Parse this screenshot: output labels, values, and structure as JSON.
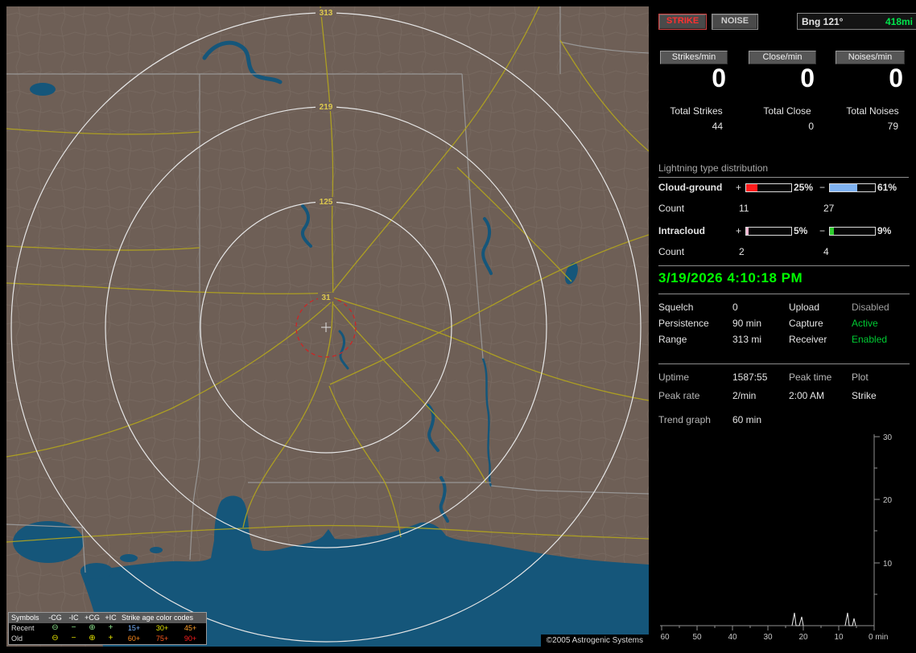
{
  "map": {
    "range_labels": [
      "313",
      "219",
      "125",
      "31"
    ],
    "copyright": "©2005 Astrogenic Systems",
    "colors": {
      "land": "#6e5f56",
      "water": "#15567a",
      "road": "#b3a51d",
      "state_border": "#9c9c9c",
      "range_ring": "#e6e6e6",
      "range_label": "#dcc84e",
      "alarm_ring": "#cc2525"
    },
    "legend": {
      "symbols_title": "Symbols",
      "symbol_columns": [
        "-CG",
        "-IC",
        "+CG",
        "+IC"
      ],
      "age_title": "Strike age color codes",
      "rows": [
        {
          "label": "Recent",
          "symbols": [
            "⊖",
            "−",
            "⊕",
            "+"
          ],
          "symbol_color": "#8ce08c",
          "ages": [
            "15+",
            "30+",
            "45+"
          ],
          "age_colors": [
            "#79b4ff",
            "#e6e600",
            "#ffa02a"
          ]
        },
        {
          "label": "Old",
          "symbols": [
            "⊖",
            "−",
            "⊕",
            "+"
          ],
          "symbol_color": "#e2e200",
          "ages": [
            "60+",
            "75+",
            "90+"
          ],
          "age_colors": [
            "#ff8c1e",
            "#ff5a1e",
            "#ff1e1e"
          ]
        }
      ]
    }
  },
  "panel": {
    "mode_buttons": [
      {
        "label": "STRIKE",
        "color": "#ff3030"
      },
      {
        "label": "NOISE",
        "color": "#cccccc"
      }
    ],
    "bearing": {
      "label": "Bng 121°",
      "distance": "418mi",
      "distance_color": "#00e64d"
    },
    "rate_columns": [
      {
        "label": "Strikes/min",
        "value": "0",
        "total_label": "Total Strikes",
        "total_value": "44"
      },
      {
        "label": "Close/min",
        "value": "0",
        "total_label": "Total Close",
        "total_value": "0"
      },
      {
        "label": "Noises/min",
        "value": "0",
        "total_label": "Total Noises",
        "total_value": "79"
      }
    ],
    "distribution": {
      "title": "Lightning type distribution",
      "rows": [
        {
          "label": "Cloud-ground",
          "plus": "+",
          "minus": "−",
          "pos_pct": "25%",
          "pos_fill": "25%",
          "pos_color": "#ff1c1c",
          "neg_pct": "61%",
          "neg_fill": "61%",
          "neg_color": "#7fb2f0",
          "count_label": "Count",
          "pos_count": "11",
          "neg_count": "27"
        },
        {
          "label": "Intracloud",
          "plus": "+",
          "minus": "−",
          "pos_pct": "5%",
          "pos_fill": "5%",
          "pos_color": "#f2b6d2",
          "neg_pct": "9%",
          "neg_fill": "9%",
          "neg_color": "#2ecc2e",
          "count_label": "Count",
          "pos_count": "2",
          "neg_count": "4"
        }
      ]
    },
    "timestamp": {
      "text": "3/19/2026 4:10:18 PM",
      "color": "#00ff00"
    },
    "status_rows": [
      {
        "label": "Squelch",
        "value": "0",
        "label2": "Upload",
        "value2": "Disabled",
        "value2_color": "#a0a0a0"
      },
      {
        "label": "Persistence",
        "value": "90 min",
        "label2": "Capture",
        "value2": "Active",
        "value2_color": "#00cc33"
      },
      {
        "label": "Range",
        "value": "313 mi",
        "label2": "Receiver",
        "value2": "Enabled",
        "value2_color": "#00cc33"
      }
    ],
    "stats_grid": {
      "r1": [
        "Uptime",
        "1587:55",
        "Peak time",
        "Plot"
      ],
      "r2": [
        "Peak rate",
        "2/min",
        "2:00 AM",
        "Strike"
      ]
    },
    "trend": {
      "label": "Trend graph",
      "value": "60 min"
    },
    "trend_graph": {
      "type": "line",
      "ylim": [
        0,
        30
      ],
      "xlim_min_ago": [
        60,
        0
      ],
      "y_ticks": [
        "30",
        "20",
        "10"
      ],
      "x_ticks": [
        "60",
        "50",
        "40",
        "30",
        "20",
        "10"
      ],
      "x_end_label": "0 min",
      "series": [
        {
          "name": "Strikes/min",
          "points": [
            {
              "min_ago": 22,
              "value": 2
            },
            {
              "min_ago": 21,
              "value": 1
            },
            {
              "min_ago": 7,
              "value": 2
            },
            {
              "min_ago": 6,
              "value": 1
            }
          ]
        }
      ]
    }
  }
}
